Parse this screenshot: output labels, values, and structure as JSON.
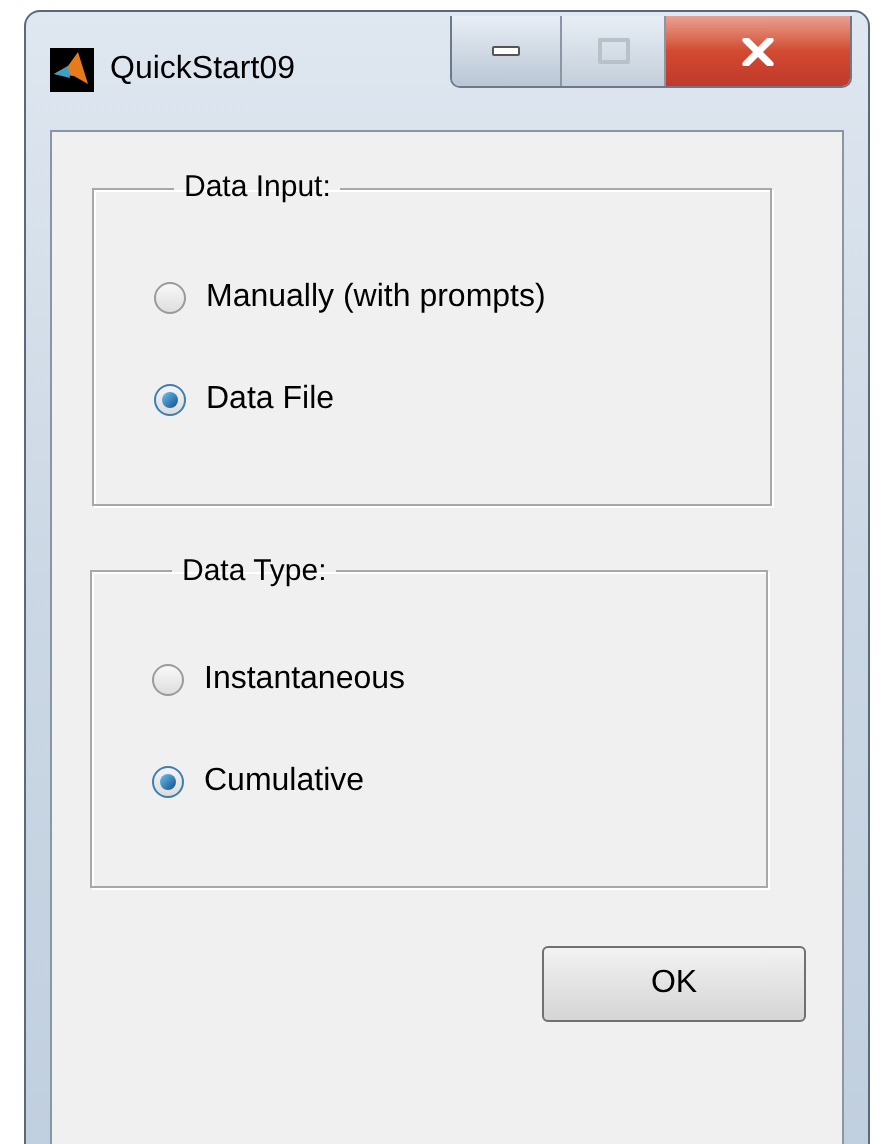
{
  "window": {
    "title": "QuickStart09"
  },
  "groups": [
    {
      "title": "Data Input:",
      "options": [
        {
          "label": "Manually (with prompts)",
          "selected": false
        },
        {
          "label": "Data File",
          "selected": true
        }
      ]
    },
    {
      "title": "Data Type:",
      "options": [
        {
          "label": "Instantaneous",
          "selected": false
        },
        {
          "label": "Cumulative",
          "selected": true
        }
      ]
    }
  ],
  "buttons": [
    {
      "label": "OK"
    }
  ]
}
